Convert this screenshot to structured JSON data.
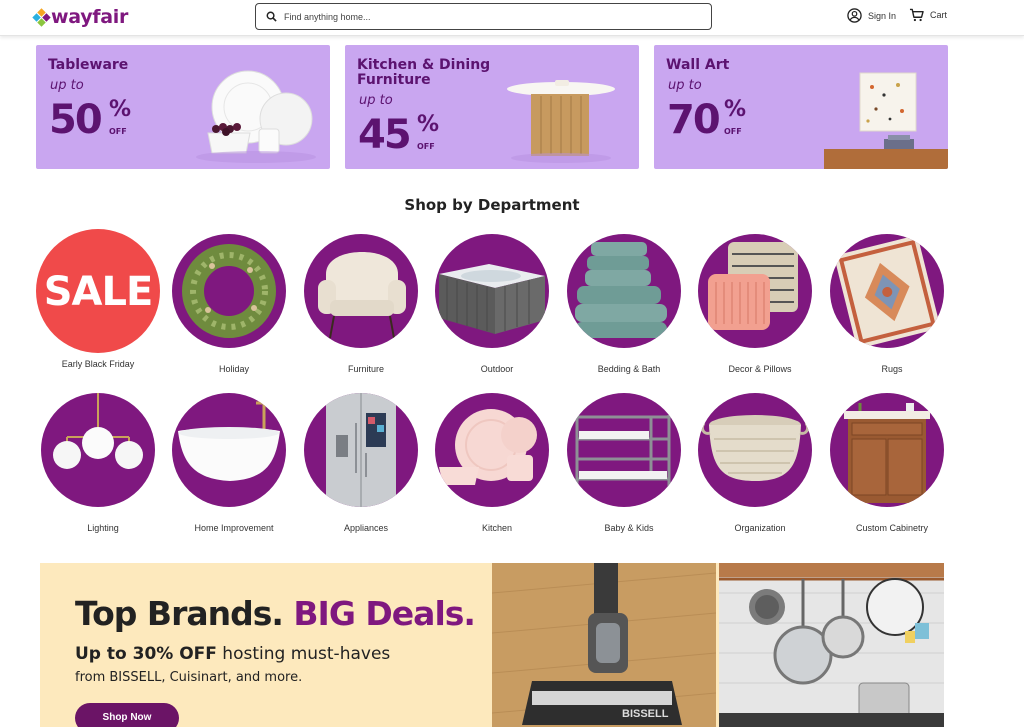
{
  "header": {
    "logo_text": "wayfair",
    "search_placeholder": "Find anything home...",
    "signin_label": "Sign In",
    "cart_label": "Cart"
  },
  "promos": [
    {
      "title": "Tableware",
      "upto": "up to",
      "value": "50",
      "pct": "%",
      "off": "OFF"
    },
    {
      "title_line1": "Kitchen & Dining",
      "title_line2": "Furniture",
      "upto": "up to",
      "value": "45",
      "pct": "%",
      "off": "OFF"
    },
    {
      "title": "Wall Art",
      "upto": "up to",
      "value": "70",
      "pct": "%",
      "off": "OFF"
    }
  ],
  "department": {
    "title": "Shop by Department",
    "sale_text": "SALE",
    "items": [
      "Early Black Friday",
      "Holiday",
      "Furniture",
      "Outdoor",
      "Bedding & Bath",
      "Decor & Pillows",
      "Rugs",
      "Lighting",
      "Home Improvement",
      "Appliances",
      "Kitchen",
      "Baby & Kids",
      "Organization",
      "Custom Cabinetry"
    ]
  },
  "banner": {
    "headline_1": "Top Brands.",
    "headline_2": "BIG Deals.",
    "sub_bold": "Up to 30% OFF",
    "sub_rest": " hosting must-haves",
    "sub2": "from BISSELL, Cuisinart, and more.",
    "button": "Shop Now",
    "vacuum_brand": "BISSELL"
  },
  "colors": {
    "brand": "#7f187f",
    "promo_bg": "#c9a6f0",
    "sale_red": "#f04a4a",
    "banner_bg": "#fde9bd"
  }
}
